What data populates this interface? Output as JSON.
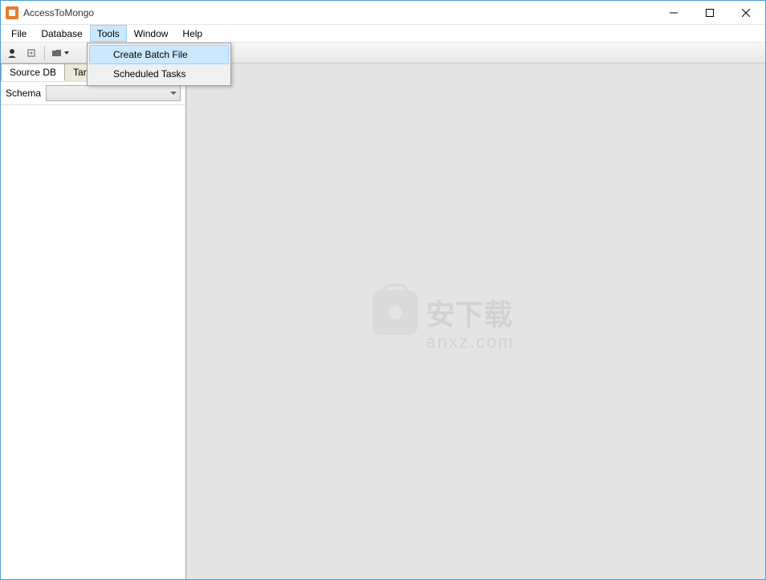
{
  "titlebar": {
    "title": "AccessToMongo"
  },
  "menubar": {
    "items": [
      "File",
      "Database",
      "Tools",
      "Window",
      "Help"
    ],
    "active_index": 2
  },
  "dropdown": {
    "items": [
      "Create Batch File",
      "Scheduled Tasks"
    ],
    "hover_index": 0
  },
  "left_panel": {
    "tabs": [
      "Source DB",
      "Target DB"
    ],
    "active_tab_index": 0,
    "tab1_visible_label": "Targe",
    "schema_label": "Schema"
  },
  "watermark": {
    "line1": "安下载",
    "line2": "anxz.com"
  }
}
